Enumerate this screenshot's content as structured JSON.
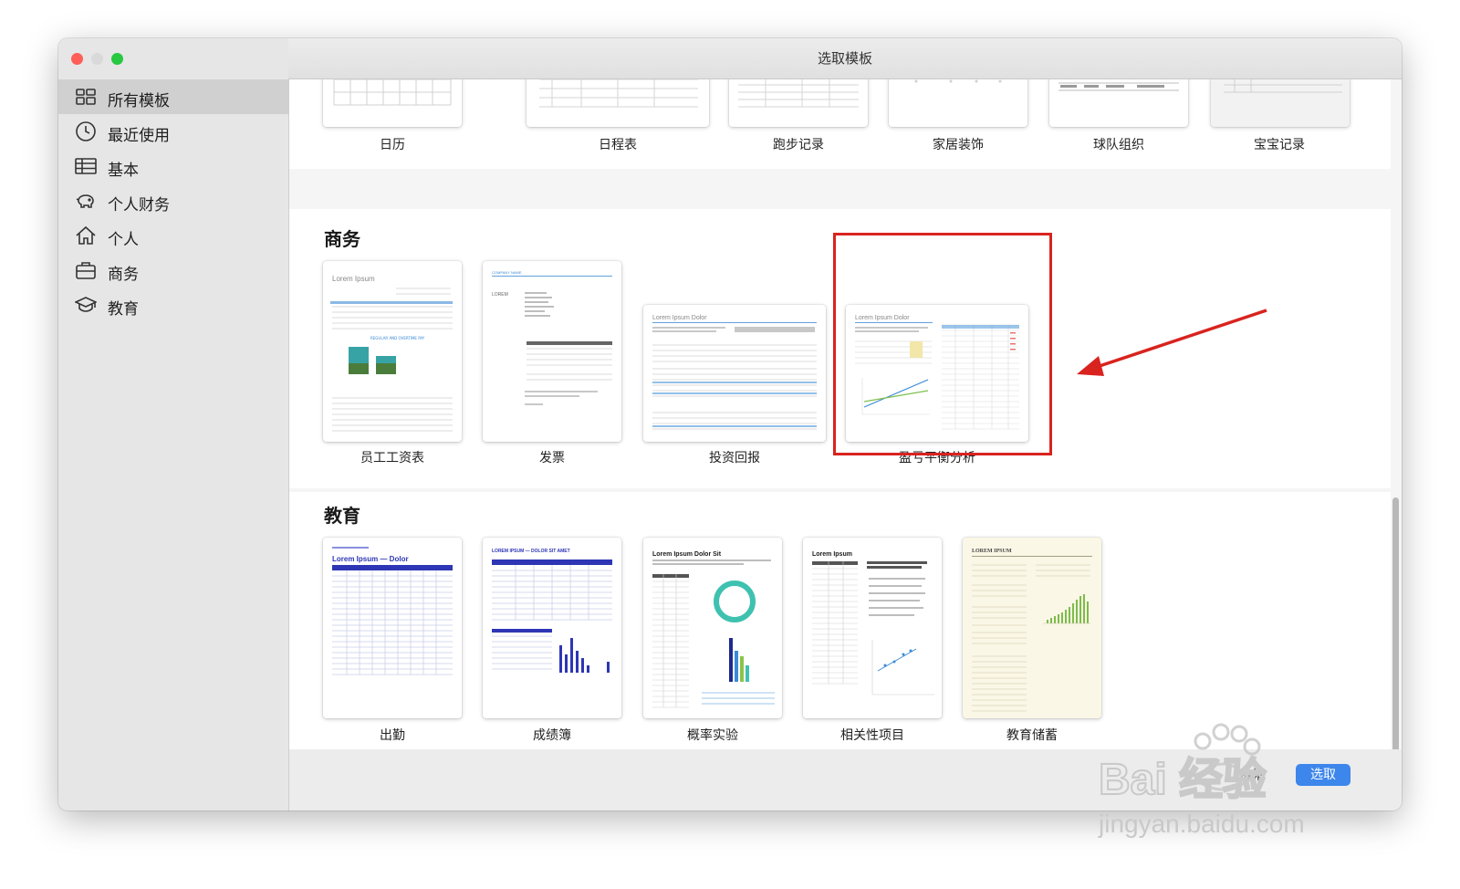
{
  "window": {
    "title": "选取模板"
  },
  "sidebar": {
    "items": [
      {
        "label": "所有模板",
        "icon": "grid-icon",
        "active": true
      },
      {
        "label": "最近使用",
        "icon": "clock-icon",
        "active": false
      },
      {
        "label": "基本",
        "icon": "table-icon",
        "active": false
      },
      {
        "label": "个人财务",
        "icon": "piggy-bank-icon",
        "active": false
      },
      {
        "label": "个人",
        "icon": "house-icon",
        "active": false
      },
      {
        "label": "商务",
        "icon": "briefcase-icon",
        "active": false
      },
      {
        "label": "教育",
        "icon": "graduation-cap-icon",
        "active": false
      }
    ]
  },
  "top_row": {
    "templates": [
      "日历",
      "日程表",
      "跑步记录",
      "家居装饰",
      "球队组织",
      "宝宝记录"
    ]
  },
  "business": {
    "heading": "商务",
    "templates": [
      "员工工资表",
      "发票",
      "投资回报",
      "盈亏平衡分析"
    ]
  },
  "education": {
    "heading": "教育",
    "templates": [
      "出勤",
      "成绩簿",
      "概率实验",
      "相关性项目",
      "教育储蓄"
    ]
  },
  "thumb_text": {
    "lorem_ipsum": "Lorem Ipsum",
    "lorem_ipsum_dolor": "Lorem Ipsum Dolor",
    "company_name": "COMPANY NAME",
    "lorem_caps": "LOREM",
    "attendance_title": "Lorem Ipsum — Dolor",
    "gradebook_title": "LOREM IPSUM — DOLOR SIT AMET",
    "probability_title": "Lorem Ipsum Dolor Sit",
    "savings_title": "LOREM IPSUM"
  },
  "footer": {
    "cancel_label": "取消",
    "choose_label": "选取"
  },
  "watermark": {
    "brand": "Bai 经验",
    "url": "jingyan.baidu.com"
  },
  "colors": {
    "highlight": "#d9231f",
    "accent_blue": "#3d86ec",
    "chart_navy": "#1f2a8c"
  }
}
